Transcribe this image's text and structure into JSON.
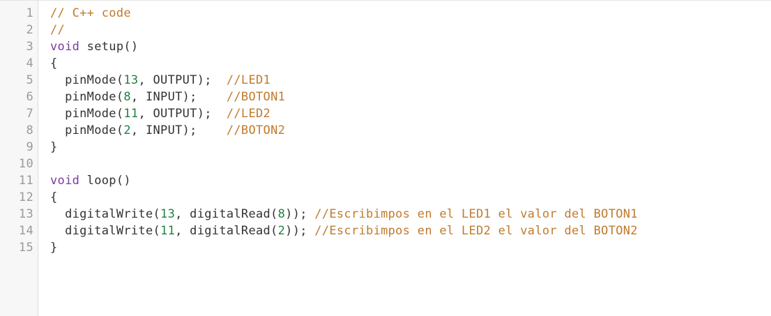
{
  "editor": {
    "language": "C++",
    "colors": {
      "background": "#ffffff",
      "gutter_background": "#f7f7f7",
      "line_number": "#9a9a9a",
      "text": "#333333",
      "comment": "#c07a2c",
      "keyword": "#7a3aa0",
      "number": "#208040"
    },
    "lines": [
      {
        "number": "1",
        "tokens": [
          {
            "type": "comment",
            "text": "// C++ code"
          }
        ]
      },
      {
        "number": "2",
        "tokens": [
          {
            "type": "comment",
            "text": "//"
          }
        ]
      },
      {
        "number": "3",
        "tokens": [
          {
            "type": "keyword",
            "text": "void"
          },
          {
            "type": "plain",
            "text": " setup()"
          }
        ]
      },
      {
        "number": "4",
        "tokens": [
          {
            "type": "plain",
            "text": "{"
          }
        ]
      },
      {
        "number": "5",
        "tokens": [
          {
            "type": "plain",
            "text": "  pinMode("
          },
          {
            "type": "number",
            "text": "13"
          },
          {
            "type": "plain",
            "text": ", OUTPUT);  "
          },
          {
            "type": "comment",
            "text": "//LED1"
          }
        ]
      },
      {
        "number": "6",
        "tokens": [
          {
            "type": "plain",
            "text": "  pinMode("
          },
          {
            "type": "number",
            "text": "8"
          },
          {
            "type": "plain",
            "text": ", INPUT);    "
          },
          {
            "type": "comment",
            "text": "//BOTON1"
          }
        ]
      },
      {
        "number": "7",
        "tokens": [
          {
            "type": "plain",
            "text": "  pinMode("
          },
          {
            "type": "number",
            "text": "11"
          },
          {
            "type": "plain",
            "text": ", OUTPUT);  "
          },
          {
            "type": "comment",
            "text": "//LED2"
          }
        ]
      },
      {
        "number": "8",
        "tokens": [
          {
            "type": "plain",
            "text": "  pinMode("
          },
          {
            "type": "number",
            "text": "2"
          },
          {
            "type": "plain",
            "text": ", INPUT);    "
          },
          {
            "type": "comment",
            "text": "//BOTON2"
          }
        ]
      },
      {
        "number": "9",
        "tokens": [
          {
            "type": "plain",
            "text": "}"
          }
        ]
      },
      {
        "number": "10",
        "tokens": []
      },
      {
        "number": "11",
        "tokens": [
          {
            "type": "keyword",
            "text": "void"
          },
          {
            "type": "plain",
            "text": " loop()"
          }
        ]
      },
      {
        "number": "12",
        "tokens": [
          {
            "type": "plain",
            "text": "{"
          }
        ]
      },
      {
        "number": "13",
        "tokens": [
          {
            "type": "plain",
            "text": "  digitalWrite("
          },
          {
            "type": "number",
            "text": "13"
          },
          {
            "type": "plain",
            "text": ", digitalRead("
          },
          {
            "type": "number",
            "text": "8"
          },
          {
            "type": "plain",
            "text": ")); "
          },
          {
            "type": "comment",
            "text": "//Escribimpos en el LED1 el valor del BOTON1"
          }
        ]
      },
      {
        "number": "14",
        "tokens": [
          {
            "type": "plain",
            "text": "  digitalWrite("
          },
          {
            "type": "number",
            "text": "11"
          },
          {
            "type": "plain",
            "text": ", digitalRead("
          },
          {
            "type": "number",
            "text": "2"
          },
          {
            "type": "plain",
            "text": ")); "
          },
          {
            "type": "comment",
            "text": "//Escribimpos en el LED2 el valor del BOTON2"
          }
        ]
      },
      {
        "number": "15",
        "tokens": [
          {
            "type": "plain",
            "text": "}"
          }
        ]
      }
    ]
  }
}
